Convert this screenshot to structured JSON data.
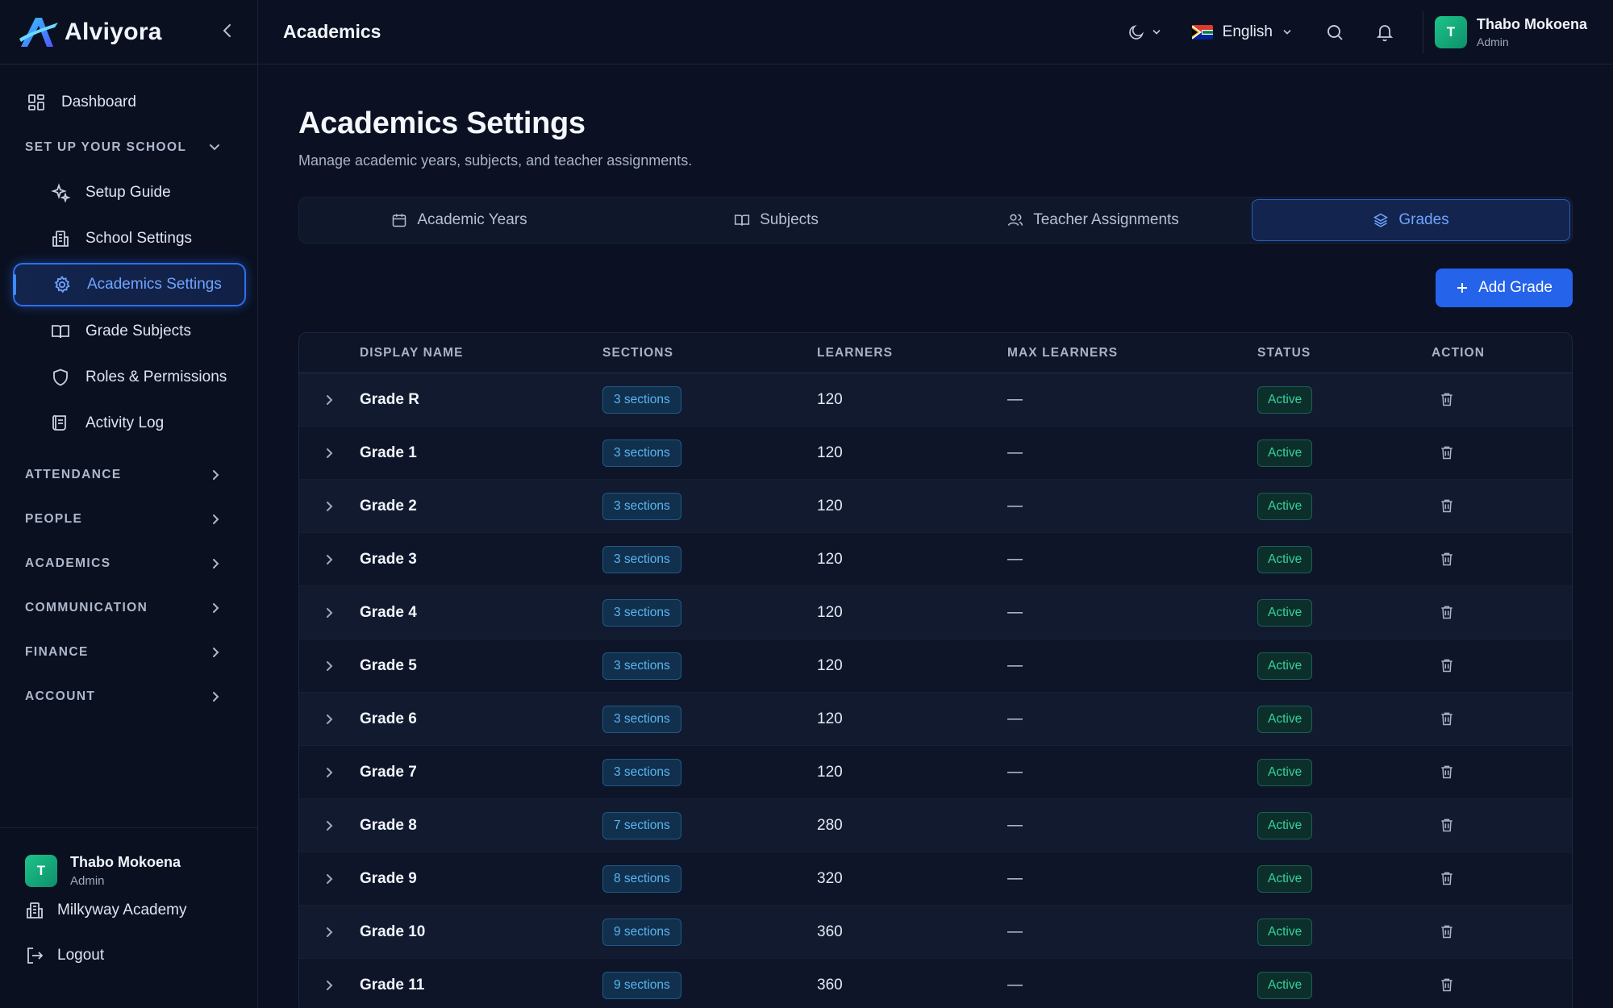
{
  "app": {
    "logo_text": "Alviyora",
    "brand_colors": {
      "accent": "#2563eb",
      "active_text": "#6fa4ff",
      "success": "#34d39a"
    }
  },
  "sidebar": {
    "dashboard": "Dashboard",
    "setup_section": "SET UP YOUR SCHOOL",
    "setup_items": [
      "Setup Guide",
      "School Settings",
      "Academics Settings",
      "Grade Subjects",
      "Roles & Permissions",
      "Activity Log"
    ],
    "sections": [
      "ATTENDANCE",
      "PEOPLE",
      "ACADEMICS",
      "COMMUNICATION",
      "FINANCE",
      "ACCOUNT"
    ],
    "user": {
      "initial": "T",
      "name": "Thabo Mokoena",
      "role": "Admin"
    },
    "school": "Milkyway Academy",
    "logout": "Logout"
  },
  "topbar": {
    "title": "Academics",
    "language": "English",
    "user": {
      "initial": "T",
      "name": "Thabo Mokoena",
      "role": "Admin"
    }
  },
  "main": {
    "title": "Academics Settings",
    "subtitle": "Manage academic years, subjects, and teacher assignments.",
    "tabs": [
      "Academic Years",
      "Subjects",
      "Teacher Assignments",
      "Grades"
    ],
    "active_tab": "Grades",
    "add_button": "Add Grade"
  },
  "table": {
    "headers": [
      "DISPLAY NAME",
      "SECTIONS",
      "LEARNERS",
      "MAX LEARNERS",
      "STATUS",
      "ACTION"
    ],
    "rows": [
      {
        "name": "Grade R",
        "sections": "3 sections",
        "learners": "120",
        "max": "—",
        "status": "Active"
      },
      {
        "name": "Grade 1",
        "sections": "3 sections",
        "learners": "120",
        "max": "—",
        "status": "Active"
      },
      {
        "name": "Grade 2",
        "sections": "3 sections",
        "learners": "120",
        "max": "—",
        "status": "Active"
      },
      {
        "name": "Grade 3",
        "sections": "3 sections",
        "learners": "120",
        "max": "—",
        "status": "Active"
      },
      {
        "name": "Grade 4",
        "sections": "3 sections",
        "learners": "120",
        "max": "—",
        "status": "Active"
      },
      {
        "name": "Grade 5",
        "sections": "3 sections",
        "learners": "120",
        "max": "—",
        "status": "Active"
      },
      {
        "name": "Grade 6",
        "sections": "3 sections",
        "learners": "120",
        "max": "—",
        "status": "Active"
      },
      {
        "name": "Grade 7",
        "sections": "3 sections",
        "learners": "120",
        "max": "—",
        "status": "Active"
      },
      {
        "name": "Grade 8",
        "sections": "7 sections",
        "learners": "280",
        "max": "—",
        "status": "Active"
      },
      {
        "name": "Grade 9",
        "sections": "8 sections",
        "learners": "320",
        "max": "—",
        "status": "Active"
      },
      {
        "name": "Grade 10",
        "sections": "9 sections",
        "learners": "360",
        "max": "—",
        "status": "Active"
      },
      {
        "name": "Grade 11",
        "sections": "9 sections",
        "learners": "360",
        "max": "—",
        "status": "Active"
      }
    ]
  }
}
